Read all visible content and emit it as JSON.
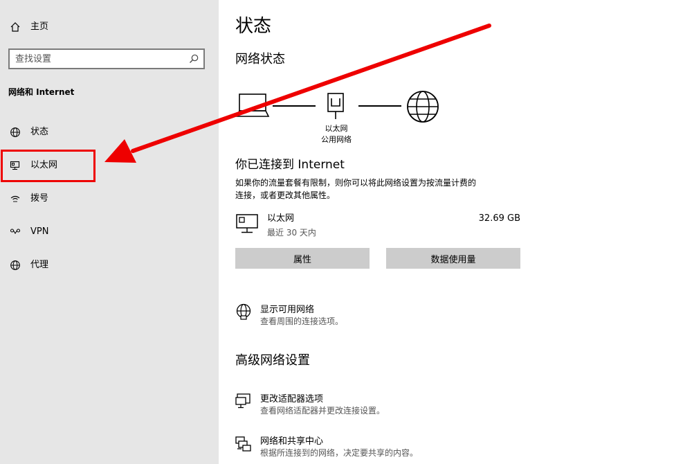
{
  "sidebar": {
    "home_label": "主页",
    "search_placeholder": "查找设置",
    "section_title": "网络和 Internet",
    "items": [
      {
        "label": "状态",
        "icon": "globe-icon"
      },
      {
        "label": "以太网",
        "icon": "ethernet-icon"
      },
      {
        "label": "拨号",
        "icon": "dialup-icon"
      },
      {
        "label": "VPN",
        "icon": "vpn-icon"
      },
      {
        "label": "代理",
        "icon": "proxy-globe-icon"
      }
    ]
  },
  "main": {
    "page_title": "状态",
    "network_status_heading": "网络状态",
    "diagram": {
      "adapter_name": "以太网",
      "network_type": "公用网络"
    },
    "connected_heading": "你已连接到 Internet",
    "connected_desc_line1": "如果你的流量套餐有限制，则你可以将此网络设置为按流量计费的",
    "connected_desc_line2": "连接，或者更改其他属性。",
    "connection": {
      "name": "以太网",
      "period": "最近 30 天内",
      "usage": "32.69 GB"
    },
    "buttons": {
      "properties": "属性",
      "data_usage": "数据使用量"
    },
    "show_networks": {
      "title": "显示可用网络",
      "desc": "查看周围的连接选项。"
    },
    "advanced_heading": "高级网络设置",
    "adapter_options": {
      "title": "更改适配器选项",
      "desc": "查看网络适配器并更改连接设置。"
    },
    "sharing_center": {
      "title": "网络和共享中心",
      "desc": "根据所连接到的网络，决定要共享的内容。"
    }
  },
  "colors": {
    "sidebar_bg": "#e6e6e6",
    "button_bg": "#cccccc",
    "annotation_red": "#ee0000"
  }
}
